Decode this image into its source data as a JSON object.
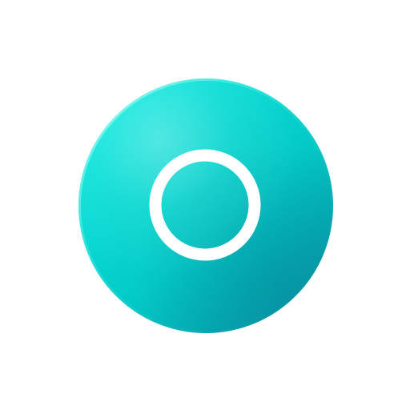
{
  "button": {
    "label": "",
    "icon": "circle-ring-icon"
  },
  "colors": {
    "page_background": "#ffffff",
    "button_light": "#09e6dc",
    "button_mid": "#04c9c6",
    "button_dark": "#0597a6",
    "icon": "#ffffff"
  }
}
